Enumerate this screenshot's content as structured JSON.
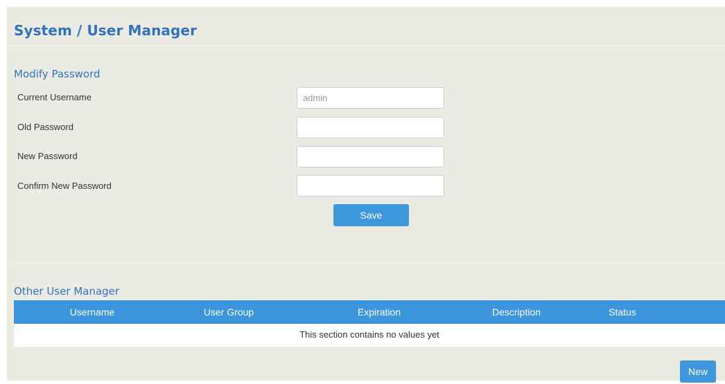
{
  "page": {
    "title": "System / User Manager"
  },
  "modify_password": {
    "heading": "Modify Password",
    "fields": [
      {
        "label": "Current Username",
        "value": "admin",
        "placeholder": ""
      },
      {
        "label": "Old Password",
        "value": "",
        "placeholder": ""
      },
      {
        "label": "New Password",
        "value": "",
        "placeholder": ""
      },
      {
        "label": "Confirm New Password",
        "value": "",
        "placeholder": ""
      }
    ],
    "save_label": "Save"
  },
  "other_users": {
    "heading": "Other User Manager",
    "columns": [
      "Username",
      "User Group",
      "Expiration",
      "Description",
      "Status"
    ],
    "rows": [],
    "empty_message": "This section contains no values yet",
    "new_label": "New"
  },
  "colors": {
    "accent": "#3b95dc",
    "heading": "#2f74c0",
    "panel_background": "#ebebe3"
  }
}
